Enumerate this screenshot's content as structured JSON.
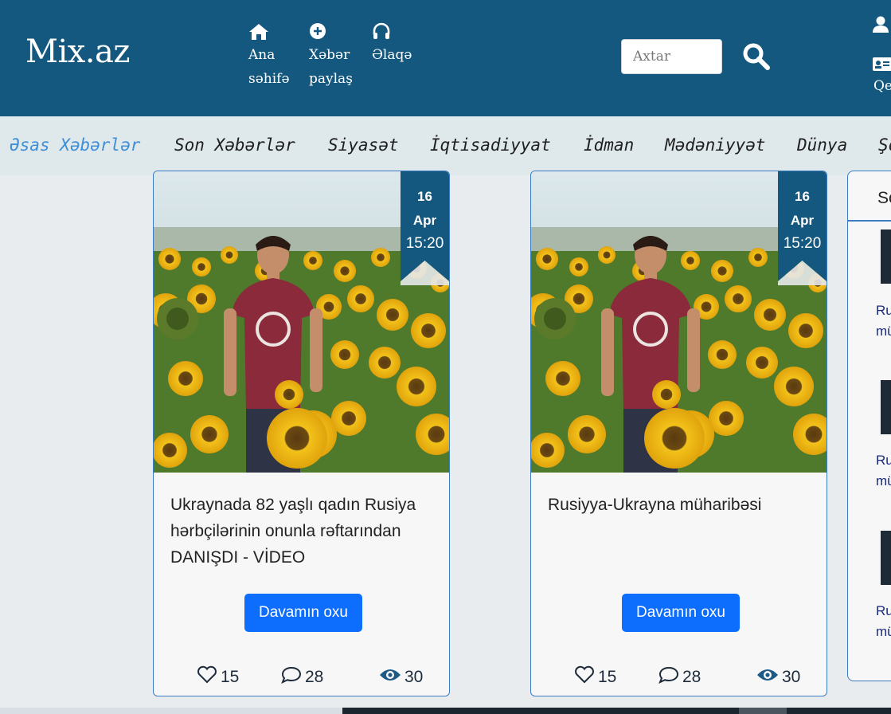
{
  "header": {
    "logo": "Mix.az",
    "nav": [
      {
        "label": "Ana\nsəhifə",
        "icon": "home-icon"
      },
      {
        "label": "Xəbər\npaylaş",
        "icon": "plus-circle-icon"
      },
      {
        "label": "Əlaqə",
        "icon": "headphones-icon"
      }
    ],
    "search": {
      "placeholder": "Axtar",
      "icon": "search-icon"
    },
    "user": {
      "label": "Qe",
      "icons": [
        "user-icon",
        "id-card-icon"
      ]
    }
  },
  "categories": [
    {
      "label": "Əsas Xəbərlər",
      "active": true
    },
    {
      "label": "Son Xəbərlər"
    },
    {
      "label": "Siyasət"
    },
    {
      "label": "İqtisadiyyat"
    },
    {
      "label": "İdman"
    },
    {
      "label": "Mədəniyyət"
    },
    {
      "label": "Dünya"
    },
    {
      "label": "Şo"
    }
  ],
  "cards": [
    {
      "date": {
        "day": "16",
        "month": "Apr",
        "time": "15:20"
      },
      "title": "Ukraynada 82 yaşlı qadın Rusiya hərbçilərinin onunla rəftarından DANIŞDI - VİDEO",
      "button": "Davamın oxu",
      "stats": {
        "likes": "15",
        "comments": "28",
        "views": "30"
      }
    },
    {
      "date": {
        "day": "16",
        "month": "Apr",
        "time": "15:20"
      },
      "title": "Rusiyya-Ukrayna müharibəsi",
      "button": "Davamın oxu",
      "stats": {
        "likes": "15",
        "comments": "28",
        "views": "30"
      }
    }
  ],
  "sidebar": {
    "heading": "So",
    "items": [
      {
        "text": "Ru\nmü"
      },
      {
        "text": "Ru\nmü"
      },
      {
        "text": "Ru\nmü"
      }
    ]
  },
  "colors": {
    "header": "#14587f",
    "accent": "#0d6efd",
    "active_category": "#3f8fd6"
  }
}
